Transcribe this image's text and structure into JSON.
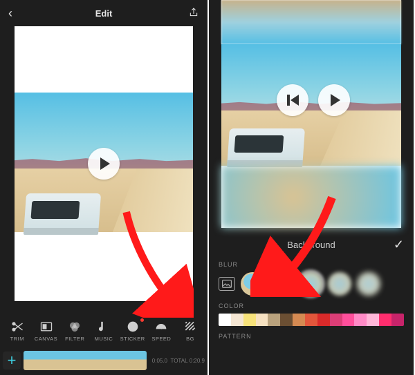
{
  "left": {
    "header": {
      "back": "‹",
      "title": "Edit",
      "share": "share"
    },
    "toolbar": {
      "items": [
        {
          "id": "trim",
          "label": "TRIM"
        },
        {
          "id": "canvas",
          "label": "CANVAS"
        },
        {
          "id": "filter",
          "label": "FILTER"
        },
        {
          "id": "music",
          "label": "MUSIC"
        },
        {
          "id": "sticker",
          "label": "STICKER",
          "badge": true
        },
        {
          "id": "speed",
          "label": "SPEED"
        },
        {
          "id": "bg",
          "label": "BG"
        }
      ]
    },
    "timeline": {
      "add_label": "+",
      "current": "0:05.0",
      "total_label": "TOTAL",
      "total": "0:20.9"
    }
  },
  "right": {
    "bg_panel": {
      "title": "Background",
      "confirm": "✓",
      "sections": {
        "blur": "BLUR",
        "color": "COLOR",
        "pattern": "PATTERN"
      },
      "blur_selected_index": 2,
      "colors": [
        "#ffffff",
        "#f5e6d3",
        "#f7e27a",
        "#f6e1c1",
        "#b9a27d",
        "#6b4f33",
        "#d58a52",
        "#e3563b",
        "#d92a2a",
        "#dc3e77",
        "#ff4f9b",
        "#ff8ac6",
        "#ffb6d8",
        "#ff2e6e",
        "#c7246a"
      ]
    }
  }
}
